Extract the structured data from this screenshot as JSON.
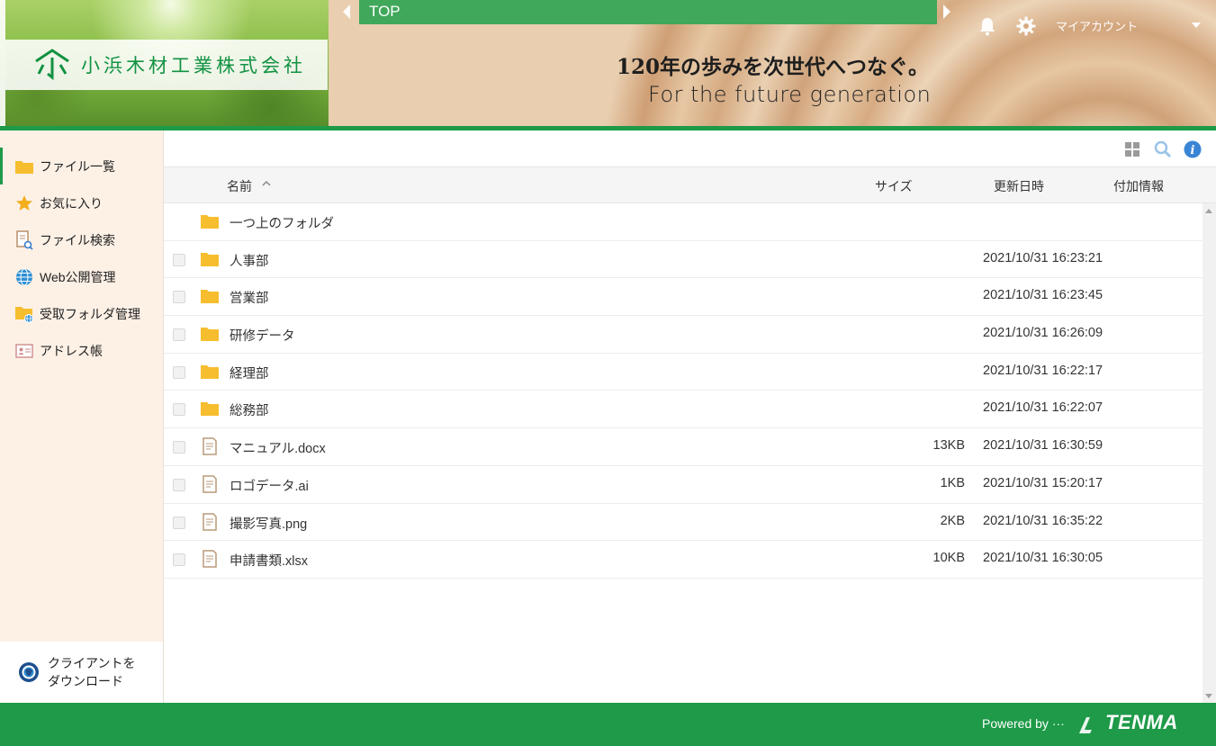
{
  "header": {
    "company_name": "小浜木材工業株式会社",
    "tab_label": "TOP",
    "slogan_jp": "120年の歩みを次世代へつなぐ。",
    "slogan_en": "For the future generation",
    "account_label": "マイアカウント"
  },
  "sidebar": {
    "items": [
      {
        "label": "ファイル一覧",
        "icon": "folder-icon"
      },
      {
        "label": "お気に入り",
        "icon": "star-icon"
      },
      {
        "label": "ファイル検索",
        "icon": "file-search-icon"
      },
      {
        "label": "Web公開管理",
        "icon": "globe-icon"
      },
      {
        "label": "受取フォルダ管理",
        "icon": "receive-folder-icon"
      },
      {
        "label": "アドレス帳",
        "icon": "address-book-icon"
      }
    ],
    "client_download_line1": "クライアントを",
    "client_download_line2": "ダウンロード"
  },
  "table": {
    "columns": {
      "name": "名前",
      "size": "サイズ",
      "modified": "更新日時",
      "extra": "付加情報"
    },
    "parent_folder": "一つ上のフォルダ",
    "rows": [
      {
        "name": "人事部",
        "type": "folder",
        "size": "",
        "modified": "2021/10/31 16:23:21"
      },
      {
        "name": "営業部",
        "type": "folder",
        "size": "",
        "modified": "2021/10/31 16:23:45"
      },
      {
        "name": "研修データ",
        "type": "folder",
        "size": "",
        "modified": "2021/10/31 16:26:09"
      },
      {
        "name": "経理部",
        "type": "folder",
        "size": "",
        "modified": "2021/10/31 16:22:17"
      },
      {
        "name": "総務部",
        "type": "folder",
        "size": "",
        "modified": "2021/10/31 16:22:07"
      },
      {
        "name": "マニュアル.docx",
        "type": "file",
        "size": "13KB",
        "modified": "2021/10/31 16:30:59"
      },
      {
        "name": "ロゴデータ.ai",
        "type": "file",
        "size": "1KB",
        "modified": "2021/10/31 15:20:17"
      },
      {
        "name": "撮影写真.png",
        "type": "file",
        "size": "2KB",
        "modified": "2021/10/31 16:35:22"
      },
      {
        "name": "申請書類.xlsx",
        "type": "file",
        "size": "10KB",
        "modified": "2021/10/31 16:30:05"
      }
    ]
  },
  "footer": {
    "powered_by": "Powered by ···",
    "brand": "TENMA"
  },
  "colors": {
    "brand_green": "#1e9a48",
    "folder_yellow": "#f6be2e",
    "sidebar_bg": "#fdf1e6"
  }
}
